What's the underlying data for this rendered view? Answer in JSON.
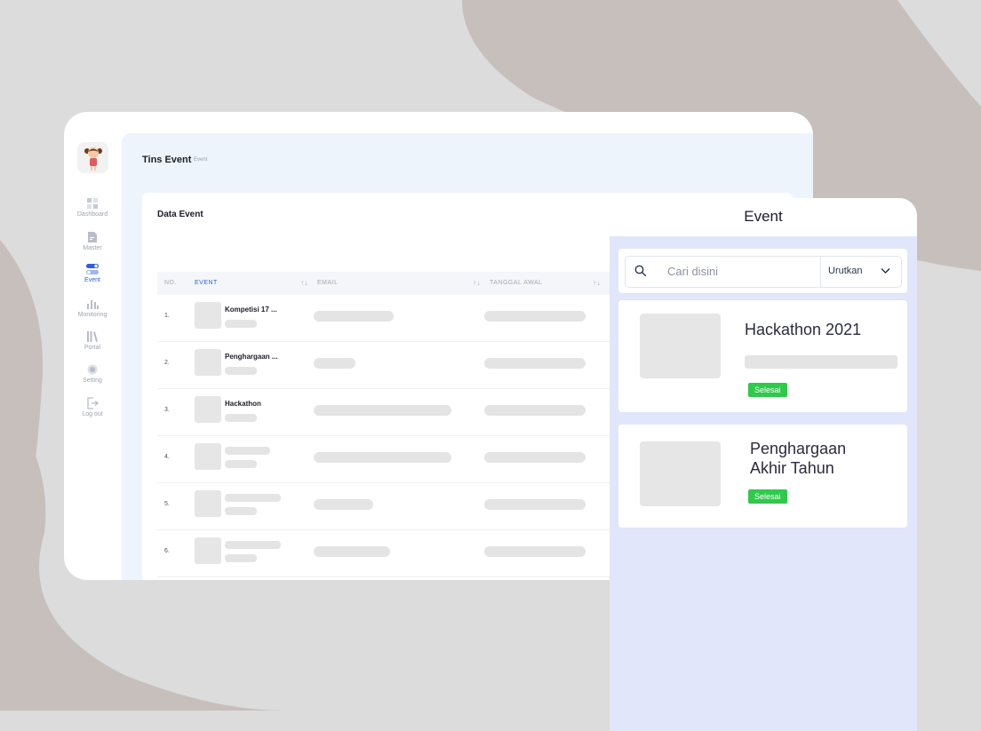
{
  "app": {
    "title": "Tins Event",
    "breadcrumb": "Event"
  },
  "sidebar": {
    "items": [
      {
        "label": "Dashboard",
        "icon": "dashboard-icon"
      },
      {
        "label": "Master",
        "icon": "document-icon"
      },
      {
        "label": "Event",
        "icon": "toggle-icon",
        "active": true
      },
      {
        "label": "Monitoring",
        "icon": "bar-chart-icon"
      },
      {
        "label": "Portal",
        "icon": "books-icon"
      },
      {
        "label": "Setting",
        "icon": "gear-icon"
      },
      {
        "label": "Log out",
        "icon": "logout-icon"
      }
    ]
  },
  "table": {
    "title": "Data Event",
    "columns": [
      "NO.",
      "EVENT",
      "EMAIL",
      "TANGGAL AWAL"
    ],
    "rows": [
      {
        "no": "1.",
        "event": "Kompetisi 17 ..."
      },
      {
        "no": "2.",
        "event": "Penghargaan ..."
      },
      {
        "no": "3.",
        "event": "Hackathon"
      },
      {
        "no": "4.",
        "event": ""
      },
      {
        "no": "5.",
        "event": ""
      },
      {
        "no": "6.",
        "event": ""
      }
    ]
  },
  "mobile": {
    "title": "Event",
    "search_placeholder": "Cari disini",
    "sort_label": "Urutkan",
    "events": [
      {
        "title": "Hackathon 2021",
        "status": "Selesai"
      },
      {
        "title_line1": "Penghargaan",
        "title_line2": "Akhir Tahun",
        "status": "Selesai"
      }
    ]
  },
  "colors": {
    "accent": "#2d5fe0",
    "status_done": "#2fc94b",
    "mobile_bg": "#e1e6fb",
    "main_bg": "#eef4fc"
  }
}
